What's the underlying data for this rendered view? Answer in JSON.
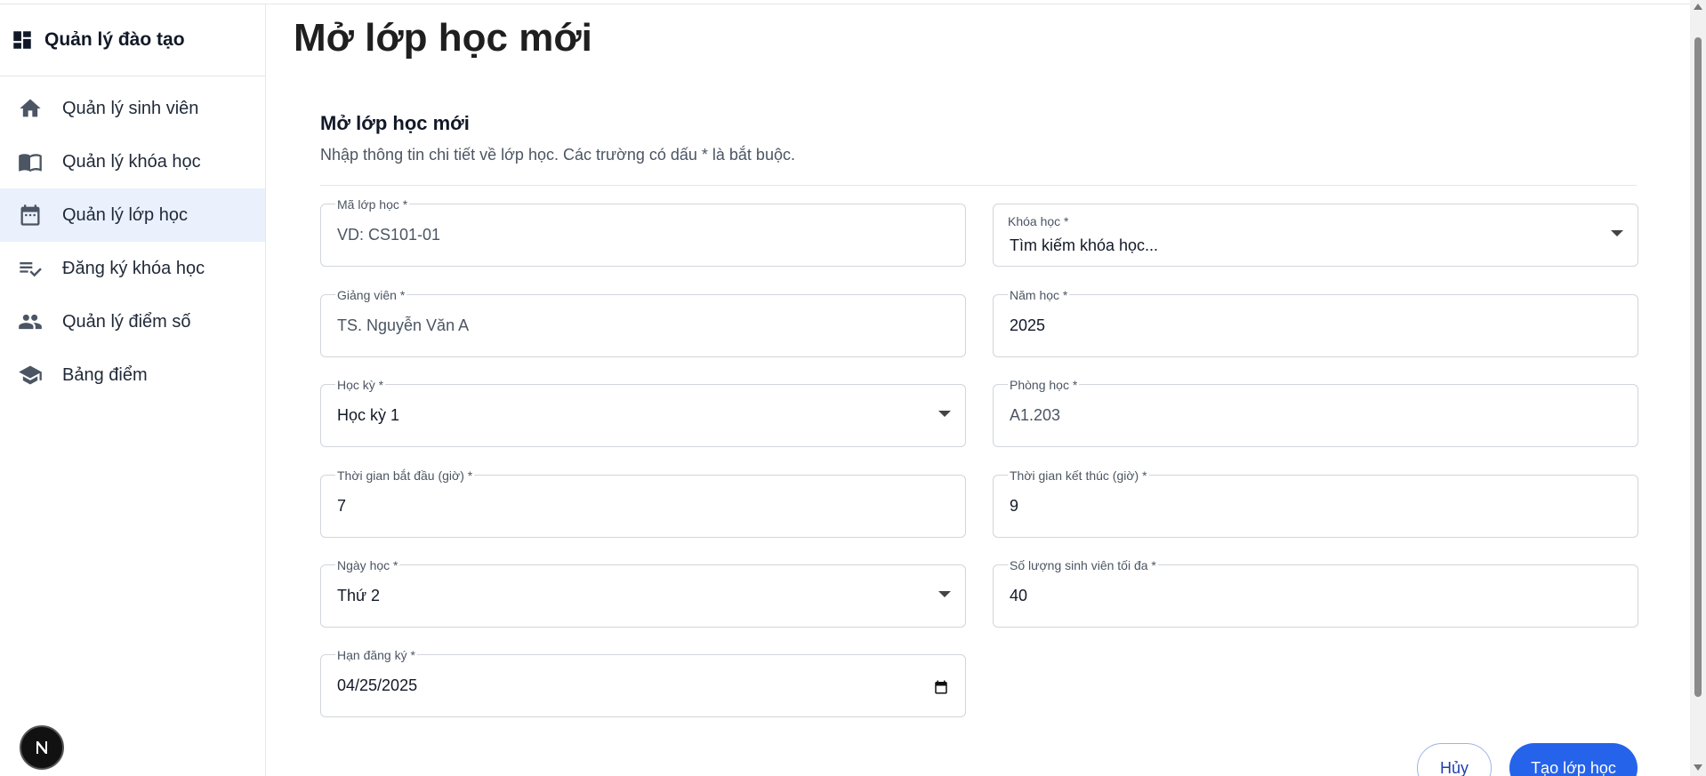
{
  "sidebar": {
    "brand": "Quản lý đào tạo",
    "items": [
      {
        "label": "Quản lý sinh viên",
        "icon": "home-icon"
      },
      {
        "label": "Quản lý khóa học",
        "icon": "book-icon"
      },
      {
        "label": "Quản lý lớp học",
        "icon": "calendar-icon",
        "active": true
      },
      {
        "label": "Đăng ký khóa học",
        "icon": "playlist-check-icon"
      },
      {
        "label": "Quản lý điểm số",
        "icon": "people-icon"
      },
      {
        "label": "Bảng điểm",
        "icon": "graduation-cap-icon"
      }
    ],
    "badge": "N"
  },
  "page": {
    "title": "Mở lớp học mới"
  },
  "form": {
    "title": "Mở lớp học mới",
    "description": "Nhập thông tin chi tiết về lớp học. Các trường có dấu * là bắt buộc.",
    "fields": {
      "class_code": {
        "label": "Mã lớp học *",
        "placeholder": "VD: CS101-01",
        "value": ""
      },
      "course": {
        "label": "Khóa học *",
        "placeholder": "Tìm kiếm khóa học...",
        "value": ""
      },
      "lecturer": {
        "label": "Giảng viên *",
        "placeholder": "TS. Nguyễn Văn A",
        "value": ""
      },
      "year": {
        "label": "Năm học *",
        "value": "2025"
      },
      "semester": {
        "label": "Học kỳ *",
        "value": "Học kỳ 1"
      },
      "room": {
        "label": "Phòng học *",
        "placeholder": "A1.203",
        "value": ""
      },
      "start_time": {
        "label": "Thời gian bắt đầu (giờ) *",
        "value": "7"
      },
      "end_time": {
        "label": "Thời gian kết thúc (giờ) *",
        "value": "9"
      },
      "day": {
        "label": "Ngày học *",
        "value": "Thứ 2"
      },
      "max_students": {
        "label": "Số lượng sinh viên tối đa *",
        "value": "40"
      },
      "deadline": {
        "label": "Hạn đăng ký *",
        "value": "04/25/2025"
      }
    },
    "buttons": {
      "cancel": "Hủy",
      "create": "Tạo lớp học"
    }
  },
  "colors": {
    "accent": "#2563eb",
    "active_bg": "#eaf1fd"
  }
}
